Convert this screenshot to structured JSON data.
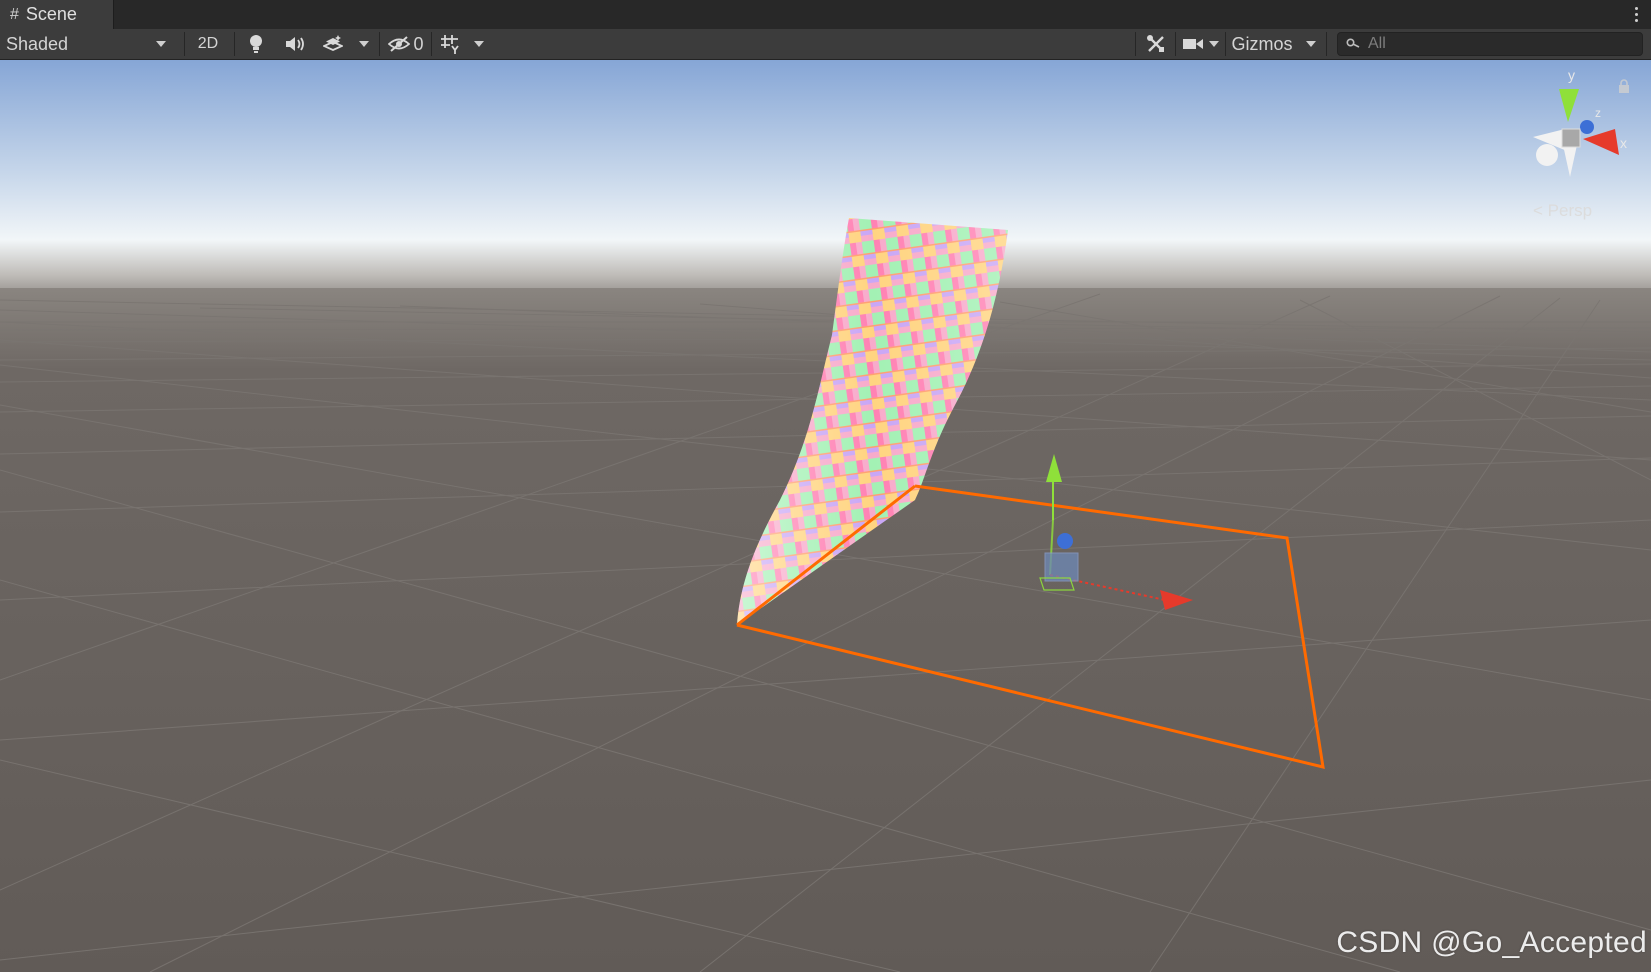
{
  "tab": {
    "icon": "grid-hash-icon",
    "title": "Scene"
  },
  "toolbar": {
    "shading_mode": "Shaded",
    "two_d_label": "2D",
    "hidden_count": "0",
    "gizmos_label": "Gizmos",
    "search_placeholder": "All"
  },
  "orientation_gizmo": {
    "y_label": "y",
    "z_label": "z",
    "x_label": "x",
    "projection_label": "Persp"
  },
  "watermark": "CSDN @Go_Accepted",
  "colors": {
    "selection_outline": "#ff6a00",
    "axis_x": "#e63a2b",
    "axis_y": "#8fe03a",
    "axis_z": "#3d6fd6",
    "toolbar_bg": "#3c3c3c",
    "ground": "#635d58"
  }
}
